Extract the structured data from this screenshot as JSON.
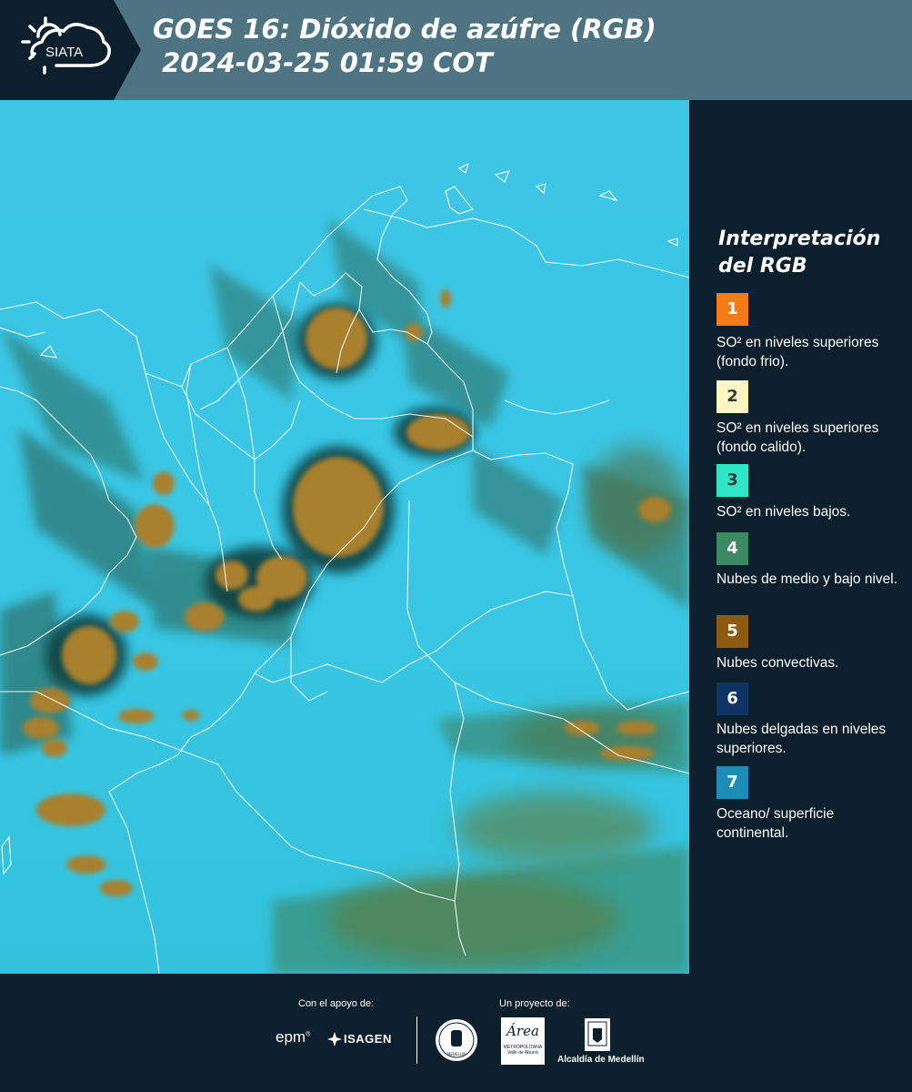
{
  "header": {
    "logo_text": "SIATA",
    "title_line1": "GOES 16: Dióxido de azúfre (RGB)",
    "title_line2": " 2024-03-25 01:59 COT"
  },
  "legend": {
    "title": "Interpretación del RGB",
    "items": [
      {
        "num": "1",
        "color": "#f47b16",
        "desc": "SO² en niveles superiores (fondo frio)."
      },
      {
        "num": "2",
        "color": "#fdf6c3",
        "desc": "SO² en niveles superiores (fondo calido)."
      },
      {
        "num": "3",
        "color": "#2fe6c7",
        "desc": "SO² en niveles bajos."
      },
      {
        "num": "4",
        "color": "#3b8a63",
        "desc": "Nubes de medio y bajo nivel."
      },
      {
        "num": "5",
        "color": "#8c5a10",
        "desc": "Nubes convectivas."
      },
      {
        "num": "6",
        "color": "#0f3362",
        "desc": "Nubes delgadas en niveles superiores."
      },
      {
        "num": "7",
        "color": "#1d8db8",
        "desc": "Oceano/ superficie continental."
      }
    ]
  },
  "footer": {
    "support_label": "Con el apoyo de:",
    "project_label": "Un proyecto de:",
    "epm": "epm",
    "isagen": "ISAGEN",
    "amva_name": "Área",
    "amva_line1": "METROPOLITANA",
    "amva_line2": "Valle de Aburrá",
    "alcaldia": "Alcaldía de Medellín",
    "seal_text": "MEDELLÍN"
  },
  "colors": {
    "header_bg": "#4e7482",
    "panel_bg": "#0b1f2c",
    "map_sky": "#38c6e4",
    "cloud_convective": "#a8802e"
  }
}
